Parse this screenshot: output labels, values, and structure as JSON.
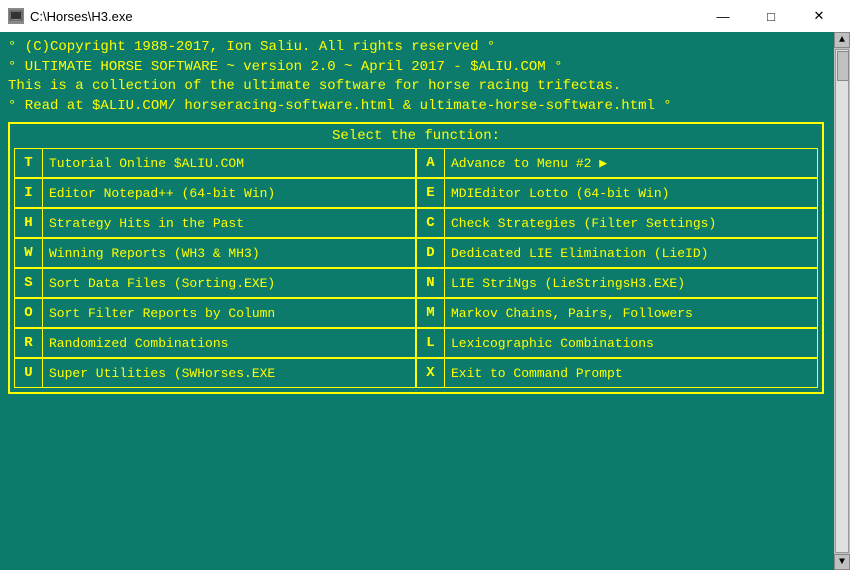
{
  "window": {
    "title": "C:\\Horses\\H3.exe",
    "controls": {
      "minimize": "—",
      "maximize": "□",
      "close": "✕"
    }
  },
  "terminal": {
    "header_lines": [
      "° (C)Copyright 1988-2017, Ion Saliu. All rights reserved           °",
      "° ULTIMATE HORSE SOFTWARE ~ version 2.0 ~ April 2017 - $ALIU.COM  °",
      "  This is a collection of the ultimate software for horse racing trifectas.",
      "° Read at $ALIU.COM/ horseracing-software.html & ultimate-horse-software.html °"
    ],
    "menu_title": "Select the function:",
    "menu_items": [
      {
        "key": "T",
        "label": "Tutorial Online $ALIU.COM"
      },
      {
        "key": "A",
        "label": "Advance to Menu #2 ▶"
      },
      {
        "key": "I",
        "label": "Editor Notepad++ (64-bit Win)"
      },
      {
        "key": "E",
        "label": "MDIEditor Lotto (64-bit Win)"
      },
      {
        "key": "H",
        "label": "Strategy Hits in the Past"
      },
      {
        "key": "C",
        "label": "Check Strategies (Filter Settings)"
      },
      {
        "key": "W",
        "label": "Winning Reports (WH3 & MH3)"
      },
      {
        "key": "D",
        "label": "Dedicated LIE Elimination (LieID)"
      },
      {
        "key": "S",
        "label": "Sort Data Files (Sorting.EXE)"
      },
      {
        "key": "N",
        "label": "LIE StriNgs (LieStringsH3.EXE)"
      },
      {
        "key": "O",
        "label": "Sort Filter Reports by Column"
      },
      {
        "key": "M",
        "label": "Markov Chains, Pairs, Followers"
      },
      {
        "key": "R",
        "label": "Randomized Combinations"
      },
      {
        "key": "L",
        "label": "Lexicographic Combinations"
      },
      {
        "key": "U",
        "label": "Super Utilities (SWHorses.EXE"
      },
      {
        "key": "X",
        "label": "Exit to Command Prompt"
      }
    ]
  }
}
